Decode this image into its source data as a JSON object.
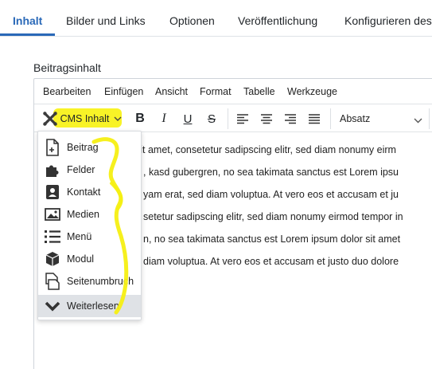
{
  "tabs": [
    {
      "label": "Inhalt"
    },
    {
      "label": "Bilder und Links"
    },
    {
      "label": "Optionen"
    },
    {
      "label": "Veröffentlichung"
    },
    {
      "label": "Konfigurieren des"
    }
  ],
  "field": {
    "label": "Beitragsinhalt"
  },
  "editor": {
    "menubar": [
      "Bearbeiten",
      "Einfügen",
      "Ansicht",
      "Format",
      "Tabelle",
      "Werkzeuge"
    ],
    "toolbar": {
      "cms_label": "CMS Inhalt",
      "bold": "B",
      "italic": "I",
      "underline": "U",
      "strike": "S",
      "format_select": "Absatz"
    },
    "content_lines": [
      "sit amet, consetetur sadipscing elitr, sed diam nonumy eirm",
      ", kasd gubergren, no sea takimata sanctus est Lorem ipsu",
      "yam erat, sed diam voluptua. At vero eos et accusam et ju",
      "setetur sadipscing elitr, sed diam nonumy eirmod tempor in",
      "n, no sea takimata sanctus est Lorem ipsum dolor sit amet",
      "diam voluptua. At vero eos et accusam et justo duo dolore"
    ]
  },
  "dropdown": {
    "items": [
      {
        "label": "Beitrag",
        "icon": "file-plus-icon"
      },
      {
        "label": "Felder",
        "icon": "puzzle-icon"
      },
      {
        "label": "Kontakt",
        "icon": "contact-card-icon"
      },
      {
        "label": "Medien",
        "icon": "image-icon"
      },
      {
        "label": "Menü",
        "icon": "list-icon"
      },
      {
        "label": "Modul",
        "icon": "cube-icon"
      },
      {
        "label": "Seitenumbruch",
        "icon": "page-break-icon"
      },
      {
        "label": "Weiterlesen",
        "icon": "chevron-down-icon"
      }
    ]
  },
  "colors": {
    "accent": "#2a69b8",
    "highlight": "#f7f210"
  }
}
